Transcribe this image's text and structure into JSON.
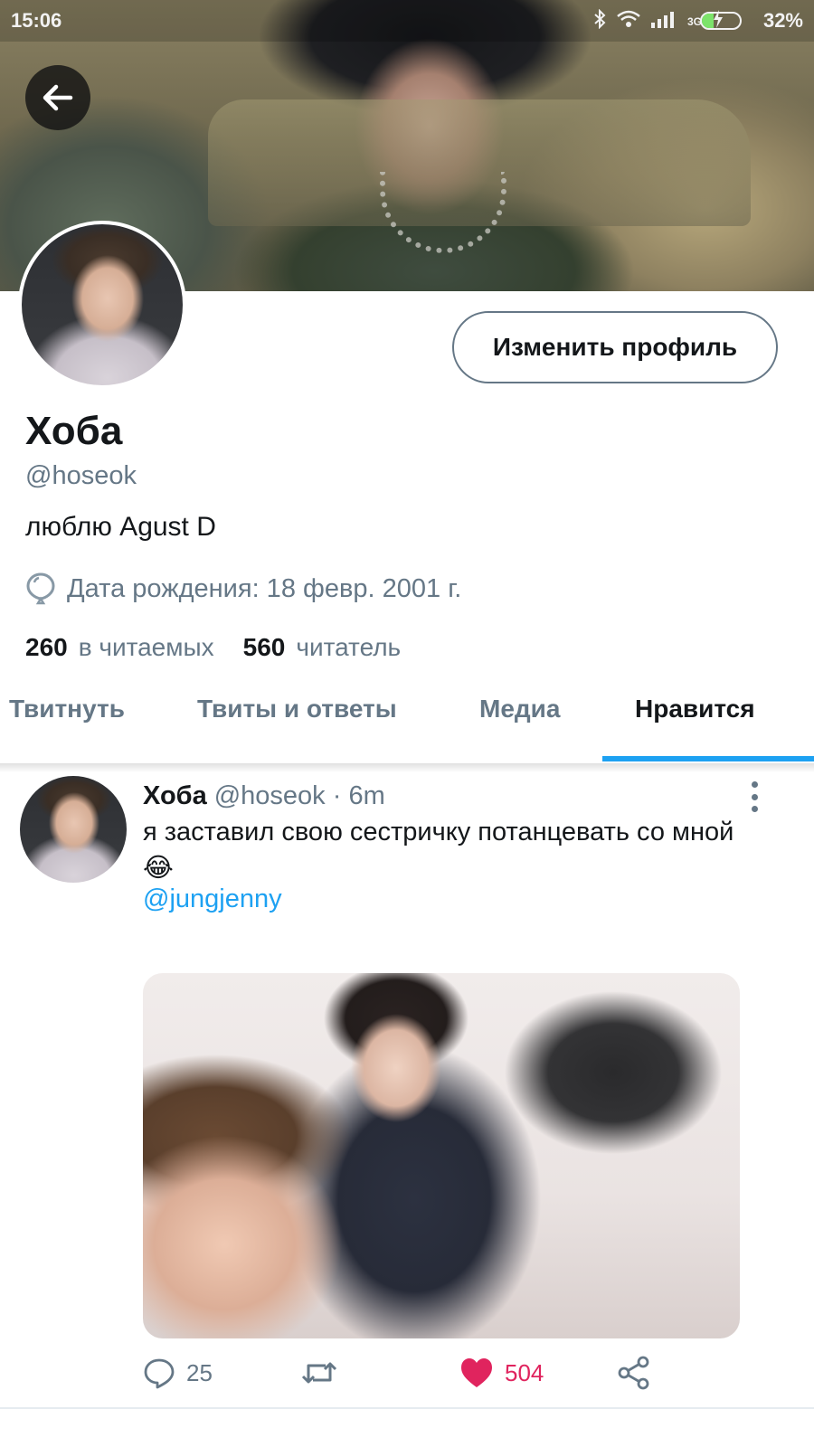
{
  "status_bar": {
    "time": "15:06",
    "network": "3G",
    "battery_percent": "32%",
    "battery_level": 0.32
  },
  "profile": {
    "edit_button": "Изменить профиль",
    "display_name": "Хоба",
    "handle": "@hoseok",
    "bio": "люблю Agust D",
    "birthday": "Дата рождения: 18 февр. 2001 г.",
    "following_count": "260",
    "following_label": "в читаемых",
    "followers_count": "560",
    "followers_label": "читатель"
  },
  "tabs": [
    {
      "label": "Твитнуть"
    },
    {
      "label": "Твиты и ответы"
    },
    {
      "label": "Медиа"
    },
    {
      "label": "Нравится",
      "active": true
    }
  ],
  "tweet": {
    "name": "Хоба",
    "handle": "@hoseok",
    "separator": "·",
    "time": "6m",
    "text": "я заставил свою сестричку потанцевать со мной😂",
    "mention": "@jungjenny",
    "replies": "25",
    "likes": "504",
    "liked": true
  },
  "colors": {
    "accent": "#1da1f2",
    "like": "#e0245e",
    "secondary_text": "#657786"
  },
  "icons": [
    "back-arrow-icon",
    "bluetooth-icon",
    "wifi-icon",
    "signal-icon",
    "battery-icon",
    "balloon-icon",
    "more-vertical-icon",
    "reply-icon",
    "retweet-icon",
    "heart-icon",
    "share-icon"
  ]
}
